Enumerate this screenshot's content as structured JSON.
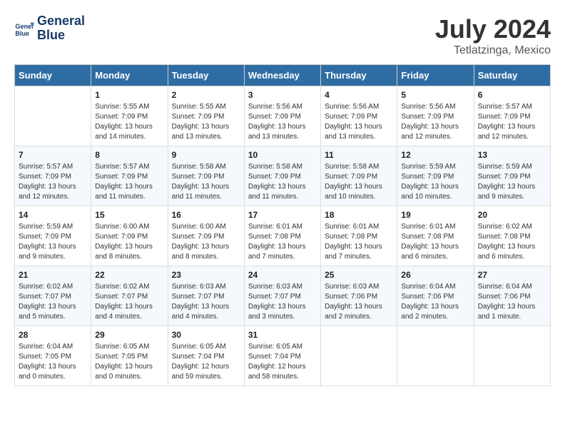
{
  "header": {
    "logo_line1": "General",
    "logo_line2": "Blue",
    "month": "July 2024",
    "location": "Tetlatzinga, Mexico"
  },
  "weekdays": [
    "Sunday",
    "Monday",
    "Tuesday",
    "Wednesday",
    "Thursday",
    "Friday",
    "Saturday"
  ],
  "weeks": [
    [
      {
        "day": "",
        "info": ""
      },
      {
        "day": "1",
        "info": "Sunrise: 5:55 AM\nSunset: 7:09 PM\nDaylight: 13 hours\nand 14 minutes."
      },
      {
        "day": "2",
        "info": "Sunrise: 5:55 AM\nSunset: 7:09 PM\nDaylight: 13 hours\nand 13 minutes."
      },
      {
        "day": "3",
        "info": "Sunrise: 5:56 AM\nSunset: 7:09 PM\nDaylight: 13 hours\nand 13 minutes."
      },
      {
        "day": "4",
        "info": "Sunrise: 5:56 AM\nSunset: 7:09 PM\nDaylight: 13 hours\nand 13 minutes."
      },
      {
        "day": "5",
        "info": "Sunrise: 5:56 AM\nSunset: 7:09 PM\nDaylight: 13 hours\nand 12 minutes."
      },
      {
        "day": "6",
        "info": "Sunrise: 5:57 AM\nSunset: 7:09 PM\nDaylight: 13 hours\nand 12 minutes."
      }
    ],
    [
      {
        "day": "7",
        "info": "Sunrise: 5:57 AM\nSunset: 7:09 PM\nDaylight: 13 hours\nand 12 minutes."
      },
      {
        "day": "8",
        "info": "Sunrise: 5:57 AM\nSunset: 7:09 PM\nDaylight: 13 hours\nand 11 minutes."
      },
      {
        "day": "9",
        "info": "Sunrise: 5:58 AM\nSunset: 7:09 PM\nDaylight: 13 hours\nand 11 minutes."
      },
      {
        "day": "10",
        "info": "Sunrise: 5:58 AM\nSunset: 7:09 PM\nDaylight: 13 hours\nand 11 minutes."
      },
      {
        "day": "11",
        "info": "Sunrise: 5:58 AM\nSunset: 7:09 PM\nDaylight: 13 hours\nand 10 minutes."
      },
      {
        "day": "12",
        "info": "Sunrise: 5:59 AM\nSunset: 7:09 PM\nDaylight: 13 hours\nand 10 minutes."
      },
      {
        "day": "13",
        "info": "Sunrise: 5:59 AM\nSunset: 7:09 PM\nDaylight: 13 hours\nand 9 minutes."
      }
    ],
    [
      {
        "day": "14",
        "info": "Sunrise: 5:59 AM\nSunset: 7:09 PM\nDaylight: 13 hours\nand 9 minutes."
      },
      {
        "day": "15",
        "info": "Sunrise: 6:00 AM\nSunset: 7:09 PM\nDaylight: 13 hours\nand 8 minutes."
      },
      {
        "day": "16",
        "info": "Sunrise: 6:00 AM\nSunset: 7:09 PM\nDaylight: 13 hours\nand 8 minutes."
      },
      {
        "day": "17",
        "info": "Sunrise: 6:01 AM\nSunset: 7:08 PM\nDaylight: 13 hours\nand 7 minutes."
      },
      {
        "day": "18",
        "info": "Sunrise: 6:01 AM\nSunset: 7:08 PM\nDaylight: 13 hours\nand 7 minutes."
      },
      {
        "day": "19",
        "info": "Sunrise: 6:01 AM\nSunset: 7:08 PM\nDaylight: 13 hours\nand 6 minutes."
      },
      {
        "day": "20",
        "info": "Sunrise: 6:02 AM\nSunset: 7:08 PM\nDaylight: 13 hours\nand 6 minutes."
      }
    ],
    [
      {
        "day": "21",
        "info": "Sunrise: 6:02 AM\nSunset: 7:07 PM\nDaylight: 13 hours\nand 5 minutes."
      },
      {
        "day": "22",
        "info": "Sunrise: 6:02 AM\nSunset: 7:07 PM\nDaylight: 13 hours\nand 4 minutes."
      },
      {
        "day": "23",
        "info": "Sunrise: 6:03 AM\nSunset: 7:07 PM\nDaylight: 13 hours\nand 4 minutes."
      },
      {
        "day": "24",
        "info": "Sunrise: 6:03 AM\nSunset: 7:07 PM\nDaylight: 13 hours\nand 3 minutes."
      },
      {
        "day": "25",
        "info": "Sunrise: 6:03 AM\nSunset: 7:06 PM\nDaylight: 13 hours\nand 2 minutes."
      },
      {
        "day": "26",
        "info": "Sunrise: 6:04 AM\nSunset: 7:06 PM\nDaylight: 13 hours\nand 2 minutes."
      },
      {
        "day": "27",
        "info": "Sunrise: 6:04 AM\nSunset: 7:06 PM\nDaylight: 13 hours\nand 1 minute."
      }
    ],
    [
      {
        "day": "28",
        "info": "Sunrise: 6:04 AM\nSunset: 7:05 PM\nDaylight: 13 hours\nand 0 minutes."
      },
      {
        "day": "29",
        "info": "Sunrise: 6:05 AM\nSunset: 7:05 PM\nDaylight: 13 hours\nand 0 minutes."
      },
      {
        "day": "30",
        "info": "Sunrise: 6:05 AM\nSunset: 7:04 PM\nDaylight: 12 hours\nand 59 minutes."
      },
      {
        "day": "31",
        "info": "Sunrise: 6:05 AM\nSunset: 7:04 PM\nDaylight: 12 hours\nand 58 minutes."
      },
      {
        "day": "",
        "info": ""
      },
      {
        "day": "",
        "info": ""
      },
      {
        "day": "",
        "info": ""
      }
    ]
  ]
}
